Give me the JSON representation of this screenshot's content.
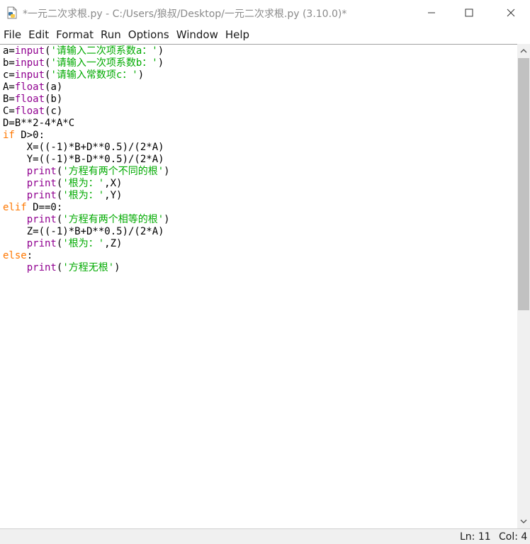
{
  "window": {
    "title": "*一元二次求根.py - C:/Users/狼叔/Desktop/一元二次求根.py (3.10.0)*"
  },
  "menu": [
    "File",
    "Edit",
    "Format",
    "Run",
    "Options",
    "Window",
    "Help"
  ],
  "code_lines": [
    [
      [
        "",
        "a="
      ],
      [
        "bi",
        "input"
      ],
      [
        "",
        "("
      ],
      [
        "st",
        "'请输入二次项系数a：'"
      ],
      [
        "",
        ")"
      ]
    ],
    [
      [
        "",
        "b="
      ],
      [
        "bi",
        "input"
      ],
      [
        "",
        "("
      ],
      [
        "st",
        "'请输入一次项系数b：'"
      ],
      [
        "",
        ")"
      ]
    ],
    [
      [
        "",
        "c="
      ],
      [
        "bi",
        "input"
      ],
      [
        "",
        "("
      ],
      [
        "st",
        "'请输入常数项c：'"
      ],
      [
        "",
        ")"
      ]
    ],
    [
      [
        "",
        "A="
      ],
      [
        "bi",
        "float"
      ],
      [
        "",
        "(a)"
      ]
    ],
    [
      [
        "",
        "B="
      ],
      [
        "bi",
        "float"
      ],
      [
        "",
        "(b)"
      ]
    ],
    [
      [
        "",
        "C="
      ],
      [
        "bi",
        "float"
      ],
      [
        "",
        "(c)"
      ]
    ],
    [
      [
        "",
        "D=B**2-4*A*C"
      ]
    ],
    [
      [
        "kw",
        "if"
      ],
      [
        "",
        " D>0:"
      ]
    ],
    [
      [
        "",
        "    X=((-1)*B+D**0.5)/(2*A)"
      ]
    ],
    [
      [
        "",
        "    Y=((-1)*B-D**0.5)/(2*A)"
      ]
    ],
    [
      [
        "",
        "    "
      ],
      [
        "bi",
        "print"
      ],
      [
        "",
        "("
      ],
      [
        "st",
        "'方程有两个不同的根'"
      ],
      [
        "",
        ")"
      ]
    ],
    [
      [
        "",
        "    "
      ],
      [
        "bi",
        "print"
      ],
      [
        "",
        "("
      ],
      [
        "st",
        "'根为：'"
      ],
      [
        "",
        ",X)"
      ]
    ],
    [
      [
        "",
        "    "
      ],
      [
        "bi",
        "print"
      ],
      [
        "",
        "("
      ],
      [
        "st",
        "'根为：'"
      ],
      [
        "",
        ",Y)"
      ]
    ],
    [
      [
        "kw",
        "elif"
      ],
      [
        "",
        " D==0:"
      ]
    ],
    [
      [
        "",
        "    "
      ],
      [
        "bi",
        "print"
      ],
      [
        "",
        "("
      ],
      [
        "st",
        "'方程有两个相等的根'"
      ],
      [
        "",
        ")"
      ]
    ],
    [
      [
        "",
        "    Z=((-1)*B+D**0.5)/(2*A)"
      ]
    ],
    [
      [
        "",
        "    "
      ],
      [
        "bi",
        "print"
      ],
      [
        "",
        "("
      ],
      [
        "st",
        "'根为：'"
      ],
      [
        "",
        ",Z)"
      ]
    ],
    [
      [
        "kw",
        "else"
      ],
      [
        "",
        ":"
      ]
    ],
    [
      [
        "",
        "    "
      ],
      [
        "bi",
        "print"
      ],
      [
        "",
        "("
      ],
      [
        "st",
        "'方程无根'"
      ],
      [
        "",
        ")"
      ]
    ]
  ],
  "status": {
    "ln": "Ln: 11",
    "col": "Col: 4"
  },
  "colors": {
    "keyword": "#ff7700",
    "builtin": "#900090",
    "string": "#00aa00"
  },
  "icons": [
    "python-file-icon",
    "minimize-icon",
    "maximize-icon",
    "close-icon",
    "scroll-up-arrow-icon",
    "scroll-down-arrow-icon"
  ]
}
